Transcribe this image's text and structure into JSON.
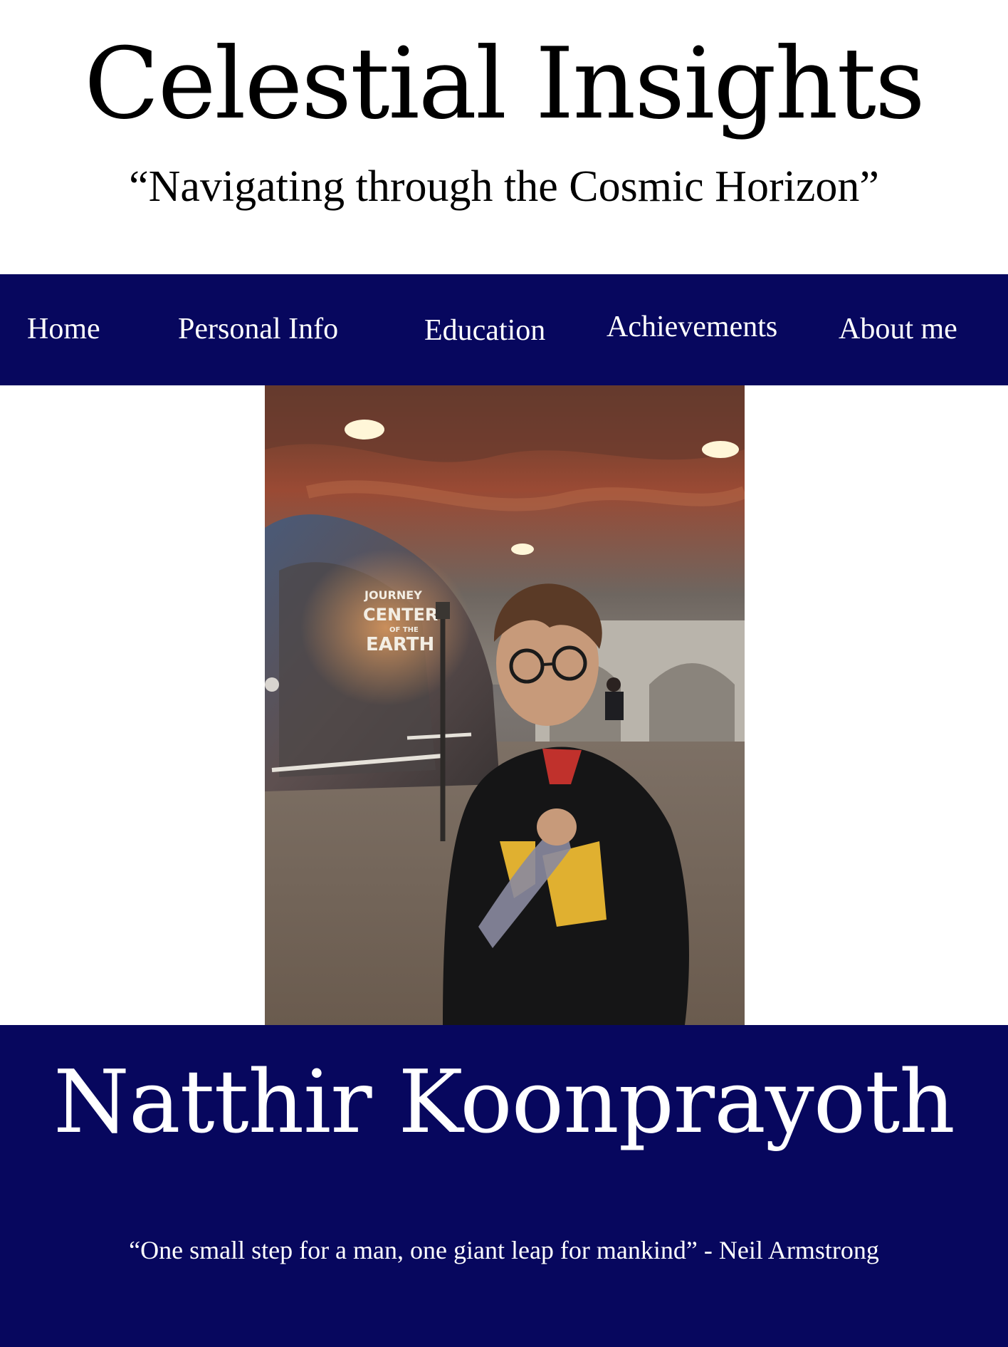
{
  "header": {
    "title": "Celestial Insights",
    "tagline": "“Navigating through the Cosmic Horizon”"
  },
  "nav": {
    "items": [
      {
        "label": "Home"
      },
      {
        "label": "Personal Info"
      },
      {
        "label": "Education"
      },
      {
        "label": "Achievements"
      },
      {
        "label": "About me"
      }
    ]
  },
  "hero": {
    "photo_subject": "portrait-photo",
    "sign_text": [
      "JOURNEY",
      "CENTER",
      "OF THE",
      "EARTH"
    ]
  },
  "footer": {
    "name": "Natthir Koonprayoth",
    "quote": "“One small step for a man, one giant leap for mankind”  - Neil Armstrong"
  },
  "colors": {
    "nav_background": "#07075e",
    "text_on_dark": "#ffffff",
    "text_on_light": "#000000",
    "page_background": "#ffffff"
  }
}
